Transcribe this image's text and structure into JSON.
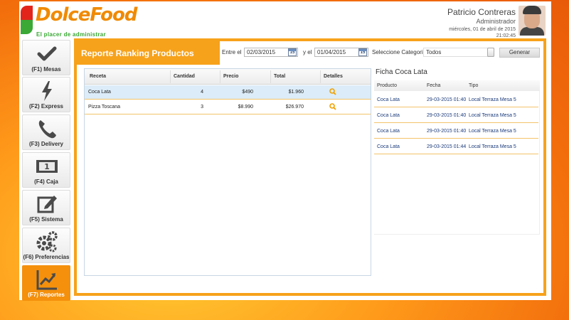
{
  "app": {
    "logo_text": "DolceFood",
    "tagline": "El placer de administrar"
  },
  "user": {
    "name": "Patricio Contreras",
    "role": "Administrador",
    "date": "miércoles, 01 de abril de 2015",
    "time": "21:02:45"
  },
  "sidebar": {
    "items": [
      {
        "label": "(F1) Mesas",
        "icon": "check-icon"
      },
      {
        "label": "(F2) Express",
        "icon": "lightning-icon"
      },
      {
        "label": "(F3) Delivery",
        "icon": "phone-icon"
      },
      {
        "label": "(F4) Caja",
        "icon": "cash-icon"
      },
      {
        "label": "(F5) Sistema",
        "icon": "edit-icon"
      },
      {
        "label": "(F6) Preferencias",
        "icon": "gears-icon"
      },
      {
        "label": "(F7) Reportes",
        "icon": "chart-icon"
      }
    ],
    "active_index": 6,
    "accent": "#f4900c"
  },
  "report": {
    "title": "Reporte Ranking Productos",
    "filters": {
      "from_label": "Entre el",
      "from_value": "02/03/2015",
      "to_label": "y el",
      "to_value": "01/04/2015",
      "calendar_day": "15",
      "category_label": "Seleccione Categoria",
      "category_value": "Todos",
      "generate_label": "Generar"
    },
    "table": {
      "headers": [
        "Receta",
        "Cantidad",
        "Precio",
        "Total",
        "Detalles"
      ],
      "rows": [
        {
          "receta": "Coca Lata",
          "cantidad": "4",
          "precio": "$490",
          "total": "$1.960"
        },
        {
          "receta": "Pizza Toscana",
          "cantidad": "3",
          "precio": "$8.990",
          "total": "$26.970"
        }
      ],
      "selected_row": 0
    }
  },
  "ficha": {
    "title": "Ficha Coca Lata",
    "headers": [
      "Producto",
      "Fecha",
      "Tipo"
    ],
    "rows": [
      {
        "producto": "Coca Lata",
        "fecha": "29-03-2015 01:40",
        "tipo": "Local Terraza Mesa 5"
      },
      {
        "producto": "Coca Lata",
        "fecha": "29-03-2015 01:40",
        "tipo": "Local Terraza Mesa 5"
      },
      {
        "producto": "Coca Lata",
        "fecha": "29-03-2015 01:40",
        "tipo": "Local Terraza Mesa 5"
      },
      {
        "producto": "Coca Lata",
        "fecha": "29-03-2015 01:44",
        "tipo": "Local Terraza Mesa 5"
      }
    ]
  }
}
